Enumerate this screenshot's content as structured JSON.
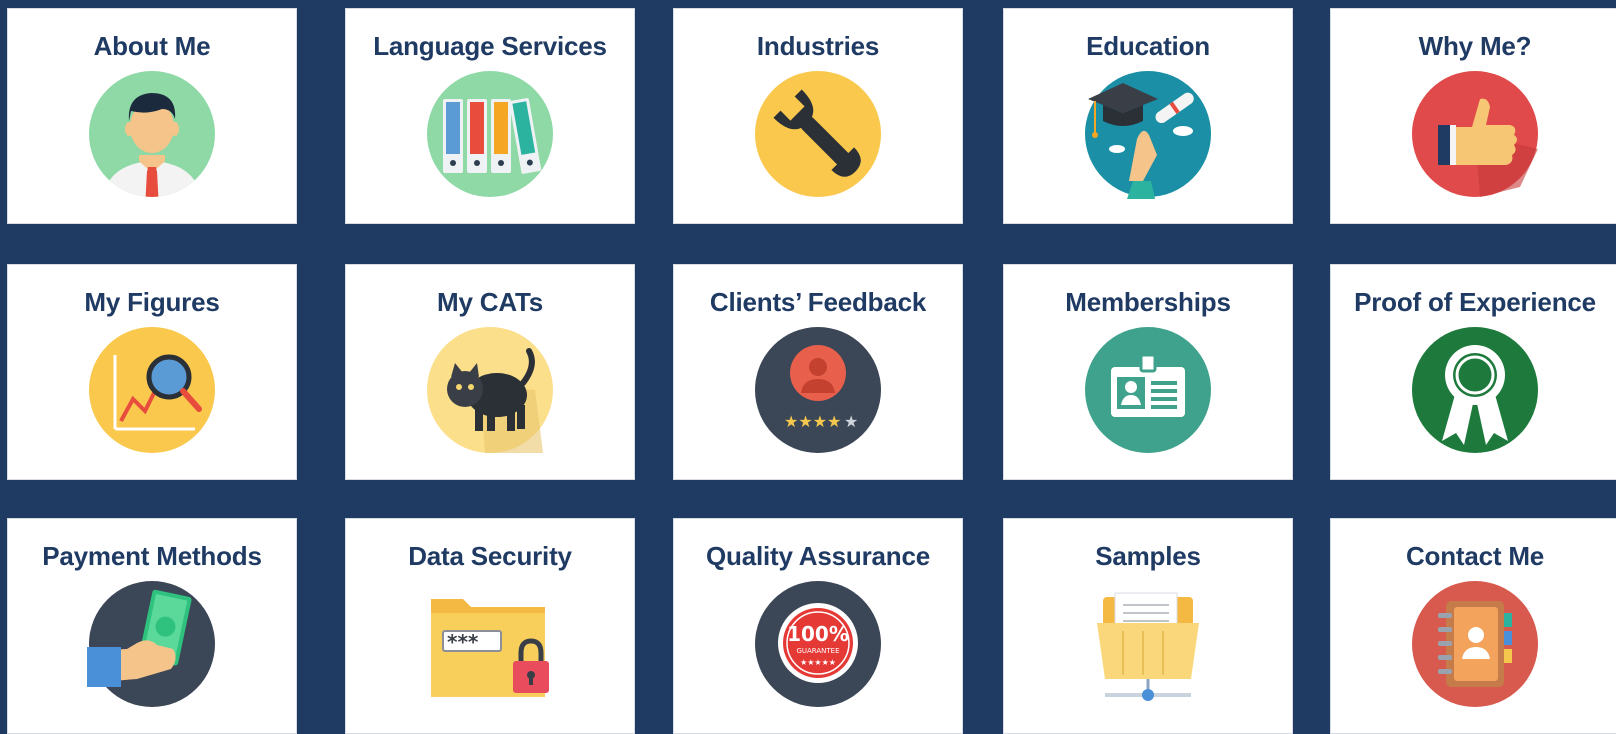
{
  "tiles": [
    {
      "title": "About Me",
      "icon": "person-icon"
    },
    {
      "title": "Language Services",
      "icon": "binders-icon"
    },
    {
      "title": "Industries",
      "icon": "wrench-icon"
    },
    {
      "title": "Education",
      "icon": "graduation-cap-icon"
    },
    {
      "title": "Why Me?",
      "icon": "thumbs-up-icon"
    },
    {
      "title": "My Figures",
      "icon": "chart-magnifier-icon"
    },
    {
      "title": "My CATs",
      "icon": "cat-icon"
    },
    {
      "title": "Clients’ Feedback",
      "icon": "rating-user-icon"
    },
    {
      "title": "Memberships",
      "icon": "id-card-icon"
    },
    {
      "title": "Proof of Experience",
      "icon": "award-ribbon-icon"
    },
    {
      "title": "Payment Methods",
      "icon": "cash-hand-icon"
    },
    {
      "title": "Data Security",
      "icon": "locked-folder-icon"
    },
    {
      "title": "Quality Assurance",
      "icon": "guarantee-seal-icon"
    },
    {
      "title": "Samples",
      "icon": "shared-folder-icon"
    },
    {
      "title": "Contact Me",
      "icon": "address-book-icon"
    }
  ],
  "badges": {
    "guarantee_pct": "100%",
    "guarantee_word": "GUARANTEE",
    "password_mask": "***"
  },
  "colors": {
    "background": "#1f3a63",
    "title": "#1f3a63",
    "about_me": "#8ed9a6",
    "language_services": "#8ed9a6",
    "industries": "#f9c84d",
    "education": "#1a8fa6",
    "why_me": "#e04a4a",
    "my_figures": "#f9c84d",
    "my_cats": "#fbdf8b",
    "clients_feedback": "#3b4656",
    "memberships": "#3ea28c",
    "proof_of_experience": "#1d7a3c",
    "payment_methods": "#3b4656",
    "quality_assurance": "#3b4656",
    "contact_me": "#d85a4f"
  }
}
